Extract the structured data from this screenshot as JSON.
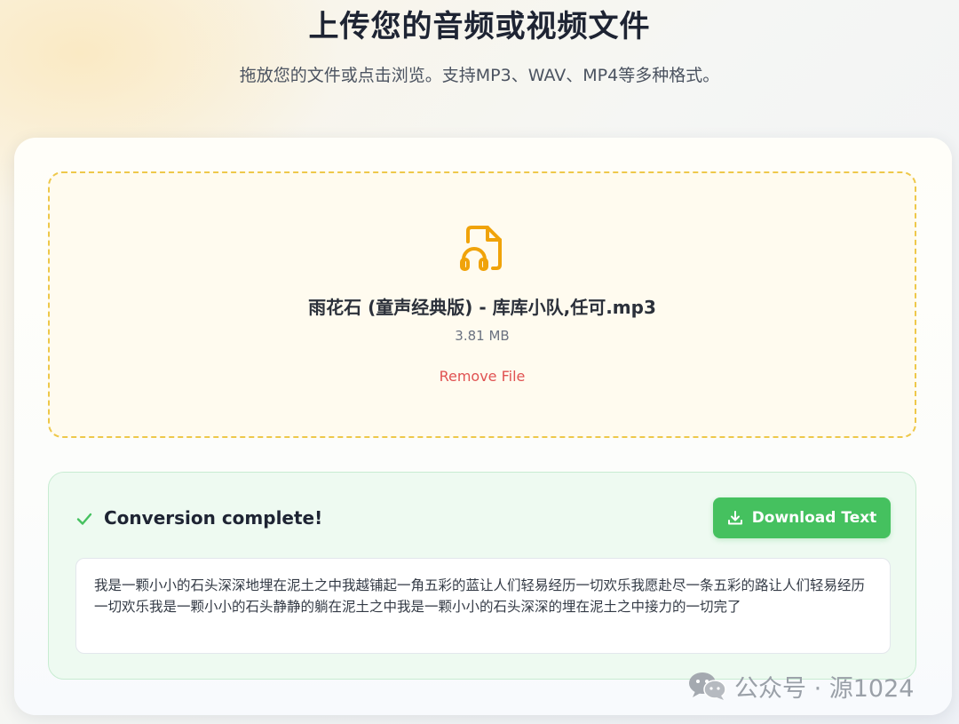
{
  "header": {
    "title": "上传您的音频或视频文件",
    "subtitle": "拖放您的文件或点击浏览。支持MP3、WAV、MP4等多种格式。"
  },
  "upload": {
    "icon": "audio-file-icon",
    "file_name": "雨花石 (童声经典版) - 库库小队,任可.mp3",
    "file_size": "3.81 MB",
    "remove_label": "Remove File"
  },
  "result": {
    "icon": "check-icon",
    "status": "Conversion complete!",
    "download_label": "Download Text",
    "download_icon": "download-icon",
    "transcript": "我是一颗小小的石头深深地埋在泥土之中我越铺起一角五彩的蓝让人们轻易经历一切欢乐我愿赴尽一条五彩的路让人们轻易经历一切欢乐我是一颗小小的石头静静的躺在泥土之中我是一颗小小的石头深深的埋在泥土之中接力的一切完了"
  },
  "watermark": {
    "icon": "wechat-icon",
    "text": "公众号 · 源1024"
  },
  "colors": {
    "accent_yellow": "#eec84a",
    "icon_orange": "#f0a30a",
    "success_green": "#45c15f",
    "remove_red": "#e05252"
  }
}
